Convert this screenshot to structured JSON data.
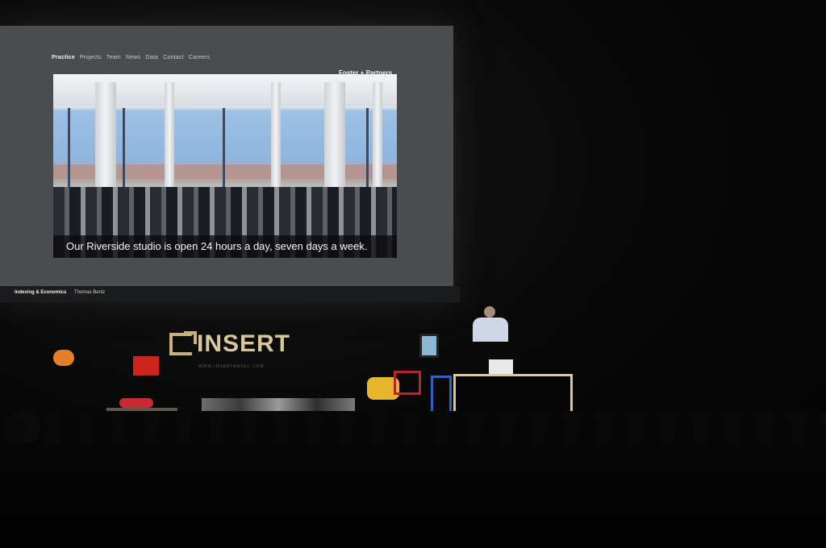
{
  "slide": {
    "nav_active": "Practice",
    "nav_items": [
      "Projects",
      "Team",
      "News",
      "Data",
      "Contact",
      "Careers"
    ],
    "subnav": "",
    "brand": "Foster + Partners",
    "caption": "Our Riverside studio is open 24 hours a day, seven days a week.",
    "footer_left_title": "Indexing & Economics",
    "footer_left_sub": "Thomas Beniz",
    "footer_right": ""
  },
  "stage": {
    "logo_text": "INSERT",
    "logo_url": "WWW.INSERTBASEL.COM"
  },
  "colors": {
    "logo": "#d8c79b",
    "screen": "#4a4c4f",
    "podium_frame": "#d9c8a4"
  }
}
